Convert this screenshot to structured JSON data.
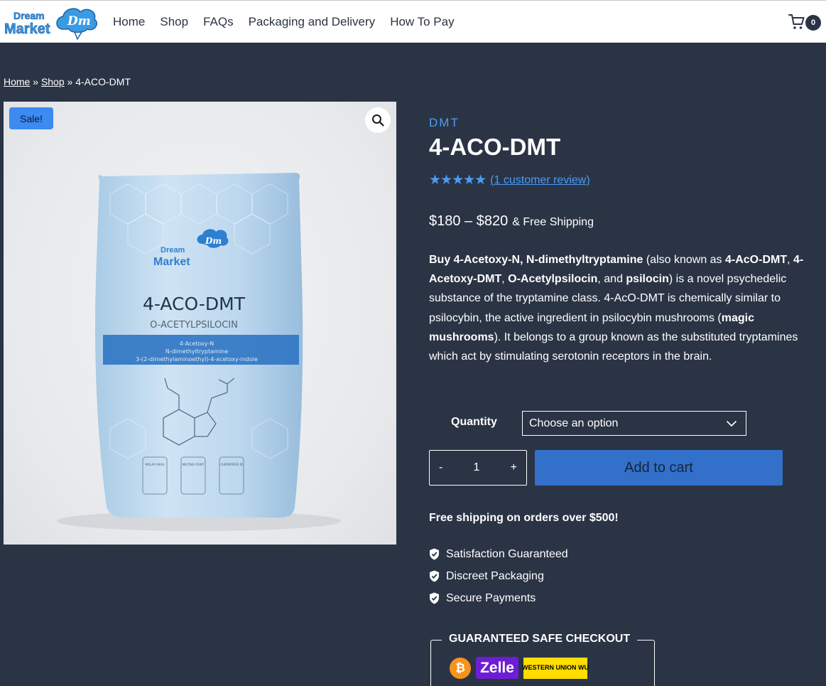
{
  "header": {
    "logo_text_top": "Dream",
    "logo_text_bottom": "Market",
    "logo_mark": "Dm",
    "nav": [
      "Home",
      "Shop",
      "FAQs",
      "Packaging and Delivery",
      "How To Pay"
    ],
    "cart_count": "0",
    "cart_icon": "shopping-cart-icon"
  },
  "breadcrumb": {
    "home": "Home",
    "shop": "Shop",
    "separator": "»",
    "current": "4-ACO-DMT"
  },
  "gallery": {
    "sale_badge": "Sale!",
    "zoom_icon": "magnifier-icon",
    "package": {
      "brand_top": "Dream",
      "brand_bottom": "Market",
      "product_name": "4-ACO-DMT",
      "subtitle": "O-ACETYLPSILOCIN",
      "band_line1": "4-Acetoxy-N",
      "band_line2": "N-dimethyltryptamine",
      "band_line3": "3-(2-dimethylaminoethyl)-4-acetoxy-indole",
      "box1": "MOLAR MASS",
      "box2": "MELTING POINT",
      "box3": "CHEMSPIDER ID"
    }
  },
  "product": {
    "category": "DMT",
    "title": "4-ACO-DMT",
    "rating": 5,
    "stars": "★★★★★",
    "review_link": "(1 customer review)",
    "price_range": "$180 – $820",
    "price_suffix": "& Free Shipping",
    "desc": {
      "p1_bold": "Buy 4-Acetoxy-N, N-dimethyltryptamine",
      "p2": " (also known as ",
      "p3_bold": "4-AcO-DMT",
      "p4": ", ",
      "p5_bold": "4-Acetoxy-DMT",
      "p6": ", ",
      "p7_bold": "O-Acetylpsilocin",
      "p8": ", and ",
      "p9_bold": "psilocin",
      "p10": ") is a novel psychedelic substance of the tryptamine class. 4-AcO-DMT is chemically similar to psilocybin, the active ingredient in psilocybin mushrooms (",
      "p11_bold": "magic mushrooms",
      "p12": "). It belongs to a group known as the substituted tryptamines which act by stimulating serotonin receptors in the brain."
    },
    "quantity_label": "Quantity",
    "select_value": "Choose an option",
    "stepper": {
      "minus": "-",
      "value": "1",
      "plus": "+"
    },
    "add_to_cart": "Add to cart",
    "free_shipping": "Free shipping on orders over $500!",
    "features": [
      "Satisfaction Guaranteed",
      "Discreet Packaging",
      "Secure Payments"
    ],
    "checkout_title": "GUARANTEED SAFE CHECKOUT",
    "payments": {
      "bitcoin": "₿",
      "zelle": "Zelle",
      "wu_line1": "WESTERN",
      "wu_line2": "UNION",
      "wu_mark": "WU"
    }
  },
  "colors": {
    "background": "#2b3445",
    "accent": "#4b9cf5",
    "button": "#3270c9"
  }
}
